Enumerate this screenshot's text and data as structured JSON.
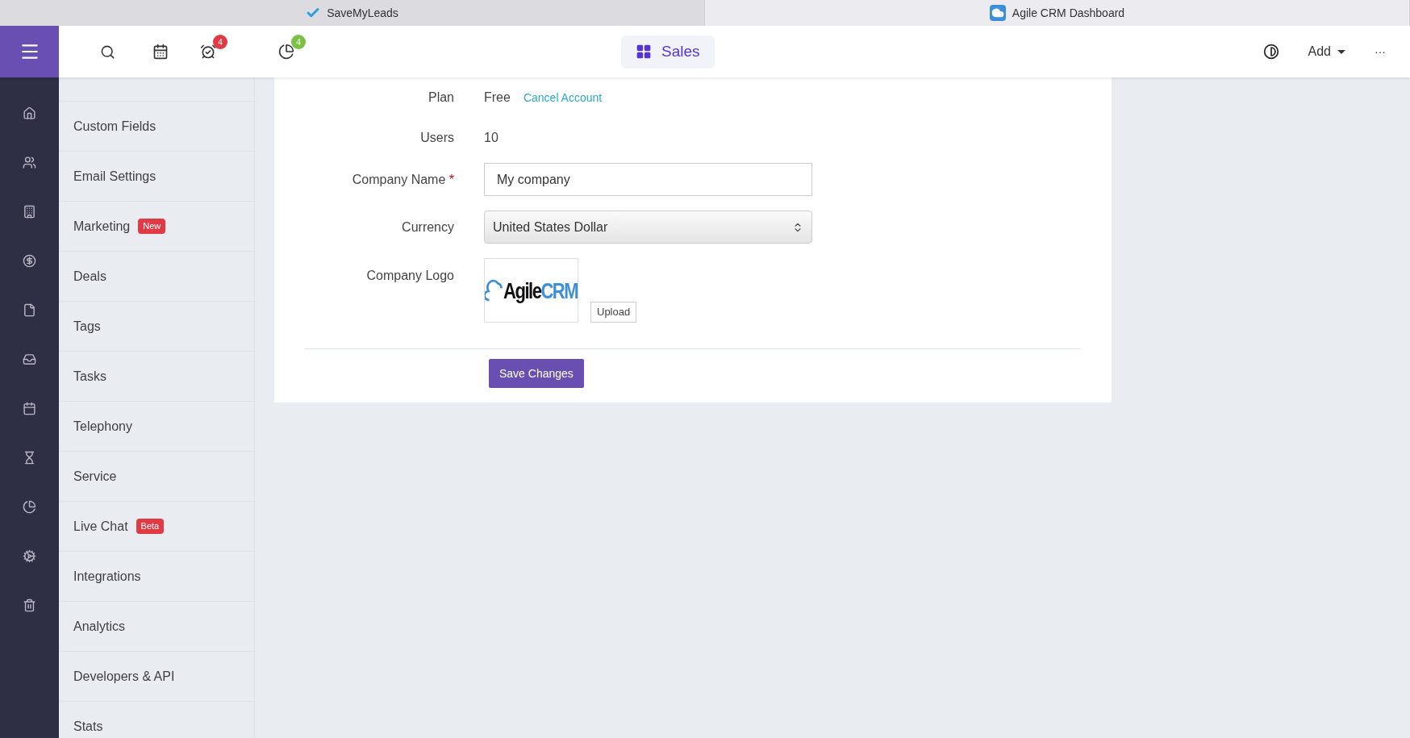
{
  "browser_tabs": [
    {
      "title": "SaveMyLeads",
      "selected": false
    },
    {
      "title": "Agile CRM Dashboard",
      "selected": true
    }
  ],
  "top_bar": {
    "reminders_badge": "4",
    "reports_badge": "4",
    "workspace": "Sales",
    "add_label": "Add",
    "more_label": "···"
  },
  "settings_menu": [
    {
      "label": "Custom Fields"
    },
    {
      "label": "Email Settings"
    },
    {
      "label": "Marketing",
      "badge": "New"
    },
    {
      "label": "Deals"
    },
    {
      "label": "Tags"
    },
    {
      "label": "Tasks"
    },
    {
      "label": "Telephony"
    },
    {
      "label": "Service"
    },
    {
      "label": "Live Chat",
      "badge": "Beta"
    },
    {
      "label": "Integrations"
    },
    {
      "label": "Analytics"
    },
    {
      "label": "Developers & API"
    },
    {
      "label": "Stats"
    }
  ],
  "form": {
    "plan_label": "Plan",
    "plan_value": "Free",
    "cancel_link": "Cancel Account",
    "users_label": "Users",
    "users_value": "10",
    "company_name_label": "Company Name",
    "required_mark": "*",
    "company_name_value": "My company",
    "currency_label": "Currency",
    "currency_value": "United States Dollar",
    "logo_label": "Company Logo",
    "logo_text_dark": "Agile",
    "logo_text_blue": "CRM",
    "upload_button": "Upload",
    "save_button": "Save Changes"
  }
}
